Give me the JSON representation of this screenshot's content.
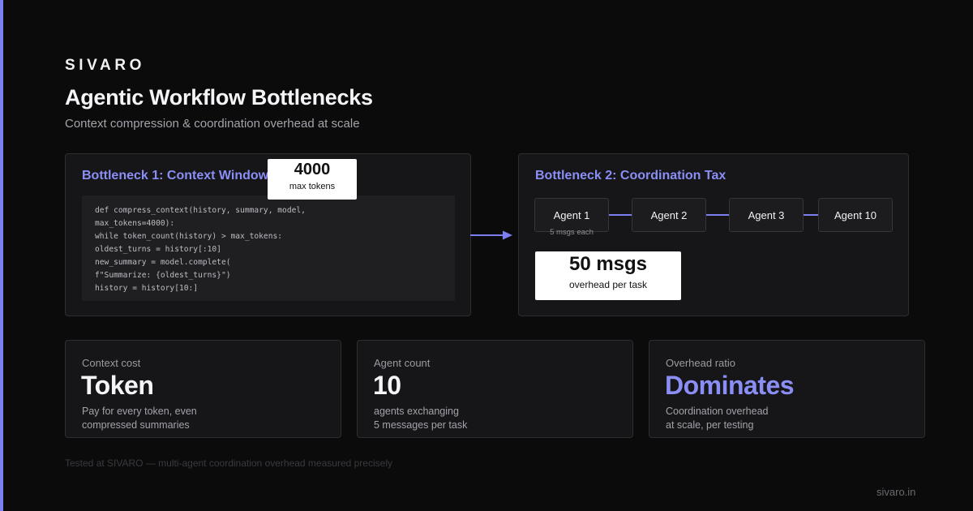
{
  "colors": {
    "accent": "#7b7ff0",
    "background": "#0b0b0c",
    "panel": "#161618"
  },
  "brand": "SIVARO",
  "title": "Agentic Workflow Bottlenecks",
  "subtitle": "Context compression & coordination overhead at scale",
  "bottleneck1": {
    "title": "Bottleneck 1: Context Window",
    "code_lines": [
      "def compress_context(history, summary, model,",
      "max_tokens=4000):",
      "while token_count(history) > max_tokens:",
      "oldest_turns = history[:10]",
      "new_summary = model.complete(",
      "f\"Summarize: {oldest_turns}\")",
      "history = history[10:]"
    ],
    "callout": {
      "value": "4000",
      "label": "max tokens"
    }
  },
  "bottleneck2": {
    "title": "Bottleneck 2: Coordination Tax",
    "agents": [
      "Agent 1",
      "Agent 2",
      "Agent 3",
      "Agent 10"
    ],
    "agent_note": "5 msgs each",
    "callout": {
      "value": "50 msgs",
      "label": "overhead per task"
    }
  },
  "stats": [
    {
      "label": "Context cost",
      "value": "Token",
      "desc_line1": "Pay for every token, even",
      "desc_line2": "compressed summaries"
    },
    {
      "label": "Agent count",
      "value": "10",
      "desc_line1": "agents exchanging",
      "desc_line2": "5 messages per task"
    },
    {
      "label": "Overhead ratio",
      "value": "Dominates",
      "desc_line1": "Coordination overhead",
      "desc_line2": "at scale, per testing"
    }
  ],
  "footnote": "Tested at SIVARO — multi-agent coordination overhead measured precisely",
  "site": "sivaro.in"
}
